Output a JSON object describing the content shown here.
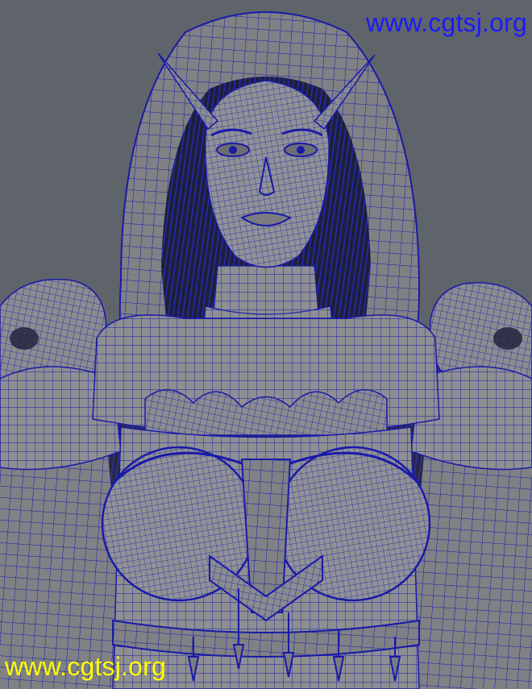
{
  "watermarks": {
    "top": "www.cgtsj.org",
    "bottom": "www.cgtsj.org"
  },
  "colors": {
    "viewport_bg": "#5e646a",
    "mesh_fill": "#8d8f92",
    "wireframe": "#1a1aa8",
    "watermark_top": "#1a1aff",
    "watermark_bottom": "#ffff00"
  }
}
